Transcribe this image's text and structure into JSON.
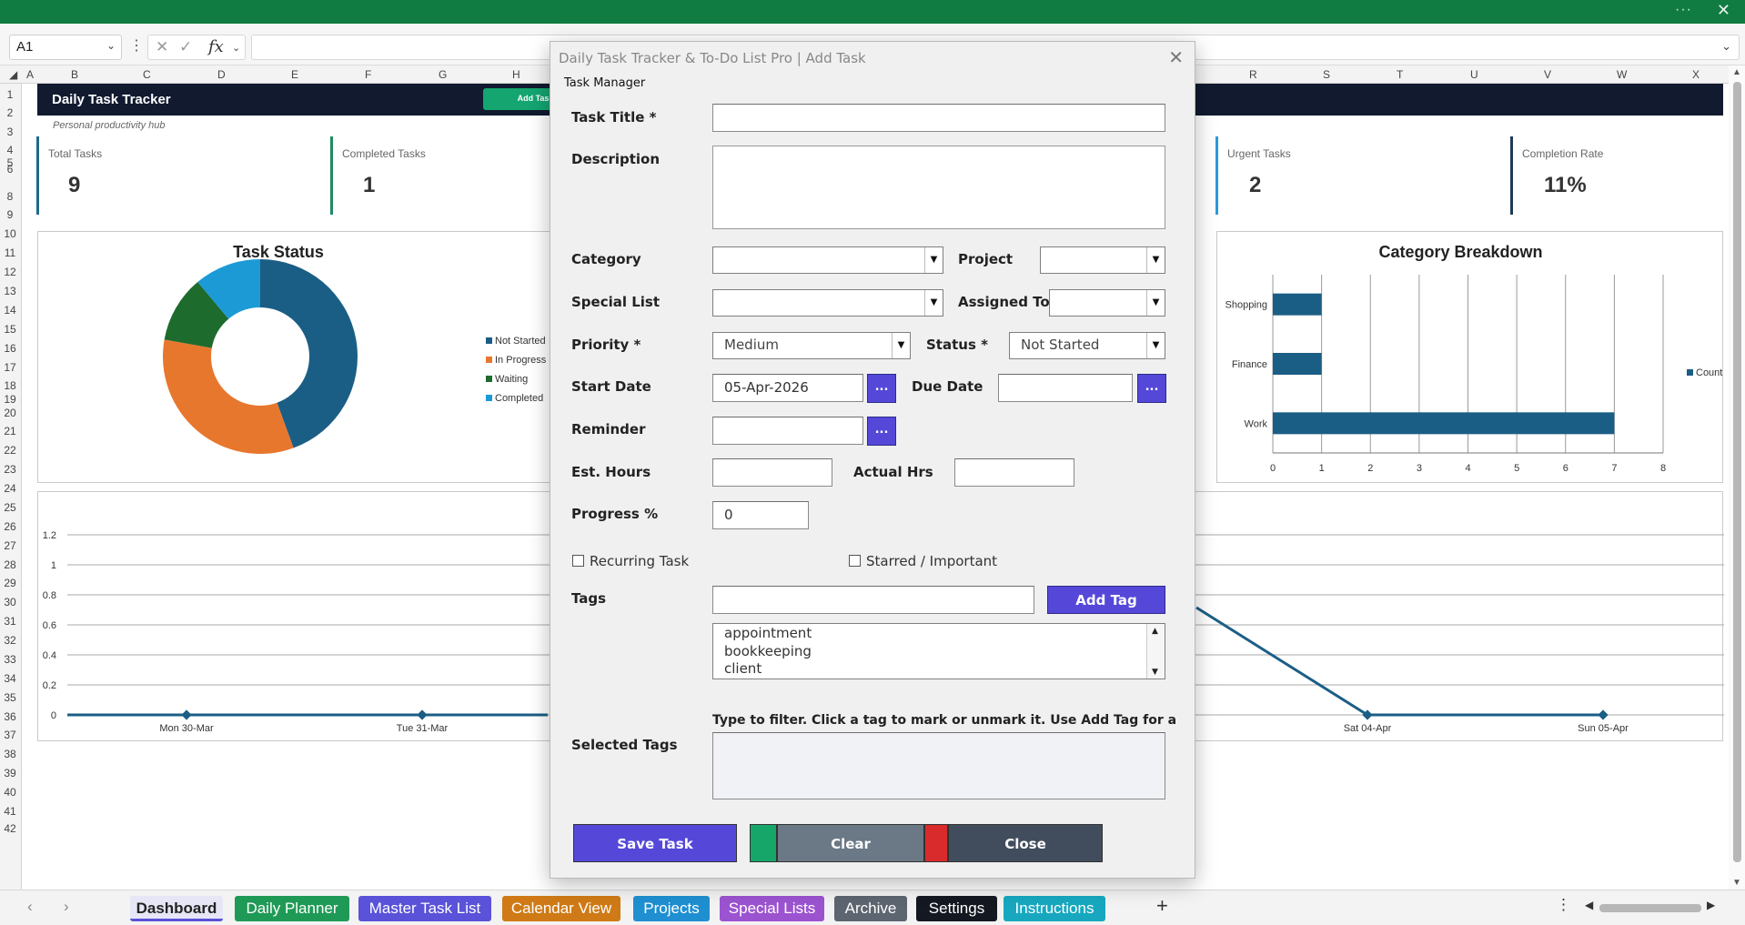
{
  "window": {
    "more_label": "···",
    "close_label": "✕"
  },
  "formula_bar": {
    "name_box": "A1",
    "fx_label": "fx",
    "formula": ""
  },
  "columns": [
    "A",
    "B",
    "C",
    "D",
    "E",
    "F",
    "G",
    "H",
    "R",
    "S",
    "T",
    "U",
    "V",
    "W",
    "X"
  ],
  "rows": [
    "1",
    "2",
    "3",
    "4",
    "5",
    "6",
    "8",
    "9",
    "10",
    "11",
    "12",
    "13",
    "14",
    "15",
    "16",
    "17",
    "18",
    "19",
    "20",
    "21",
    "22",
    "23",
    "24",
    "25",
    "26",
    "27",
    "28",
    "29",
    "30",
    "31",
    "32",
    "33",
    "34",
    "35",
    "36",
    "37",
    "38",
    "39",
    "40",
    "41",
    "42"
  ],
  "dashboard": {
    "title": "Daily Task Tracker",
    "add_task_button": "Add Tas",
    "subtitle": "Personal productivity hub",
    "kpis": [
      {
        "label": "Total Tasks",
        "value": "9"
      },
      {
        "label": "Completed Tasks",
        "value": "1"
      },
      {
        "label": "Urgent Tasks",
        "value": "2"
      },
      {
        "label": "Completion Rate",
        "value": "11%"
      }
    ]
  },
  "chart_data": [
    {
      "type": "pie",
      "title": "Task Status",
      "donut": true,
      "categories": [
        "Not Started",
        "In Progress",
        "Waiting",
        "Completed"
      ],
      "values": [
        4,
        3,
        1,
        1
      ],
      "colors": [
        "#1b5e85",
        "#e8772e",
        "#1e6b2e",
        "#1c9ad6"
      ],
      "legend": "right"
    },
    {
      "type": "bar",
      "orientation": "horizontal",
      "title": "Category Breakdown",
      "categories": [
        "Shopping",
        "Finance",
        "Work"
      ],
      "series": [
        {
          "name": "Count",
          "values": [
            1,
            1,
            7
          ]
        }
      ],
      "xlim": [
        0,
        8
      ],
      "xticks": [
        "0",
        "1",
        "2",
        "3",
        "4",
        "5",
        "6",
        "7",
        "8"
      ],
      "grid": true,
      "legend": "right",
      "color": "#1b5e85"
    },
    {
      "type": "line",
      "title": "",
      "ylim": [
        0,
        1.2
      ],
      "yticks": [
        "0",
        "0.2",
        "0.4",
        "0.6",
        "0.8",
        "1",
        "1.2"
      ],
      "x_visible": [
        "Mon 30-Mar",
        "Tue 31-Mar",
        "Sat 04-Apr",
        "Sun 05-Apr"
      ],
      "series": [
        {
          "values_visible": [
            0,
            0,
            0,
            0
          ]
        }
      ],
      "color": "#1b5e85",
      "grid": true
    }
  ],
  "dialog": {
    "title": "Daily Task Tracker & To-Do List Pro | Add Task",
    "close": "✕",
    "frame_label": "Task Manager",
    "labels": {
      "task_title": "Task Title *",
      "description": "Description",
      "category": "Category",
      "project": "Project",
      "special_list": "Special List",
      "assigned_to": "Assigned To",
      "priority": "Priority *",
      "status": "Status *",
      "start_date": "Start Date",
      "due_date": "Due Date",
      "reminder": "Reminder",
      "est_hours": "Est. Hours",
      "actual_hrs": "Actual Hrs",
      "progress": "Progress %",
      "tags": "Tags",
      "selected_tags": "Selected Tags"
    },
    "values": {
      "task_title": "",
      "description": "",
      "category": "",
      "project": "",
      "special_list": "",
      "assigned_to": "",
      "priority": "Medium",
      "status": "Not Started",
      "start_date": "05-Apr-2026",
      "due_date": "",
      "reminder": "",
      "est_hours": "",
      "actual_hrs": "",
      "progress": "0",
      "tag_input": ""
    },
    "picker_label": "...",
    "checkboxes": {
      "recurring": "Recurring Task",
      "starred": "Starred / Important"
    },
    "add_tag_button": "Add Tag",
    "tag_list": [
      "appointment",
      "bookkeeping",
      "client"
    ],
    "hint": "Type to filter. Click a tag to mark or unmark it. Use Add Tag for a",
    "buttons": {
      "save": "Save Task",
      "clear": "Clear",
      "close": "Close"
    }
  },
  "sheet_tabs": [
    {
      "label": "Dashboard",
      "color": "#e9e9f7",
      "active": true
    },
    {
      "label": "Daily Planner",
      "color": "#1f9a56"
    },
    {
      "label": "Master Task List",
      "color": "#5a52d8"
    },
    {
      "label": "Calendar View",
      "color": "#cf7a16"
    },
    {
      "label": "Projects",
      "color": "#1f8fd1"
    },
    {
      "label": "Special Lists",
      "color": "#9b53cf"
    },
    {
      "label": "Archive",
      "color": "#5d6570"
    },
    {
      "label": "Settings",
      "color": "#141821"
    },
    {
      "label": "Instructions",
      "color": "#17a8bf"
    }
  ],
  "tabbar": {
    "add_label": "+",
    "prev": "‹",
    "next": "›",
    "menu": "⋮"
  }
}
